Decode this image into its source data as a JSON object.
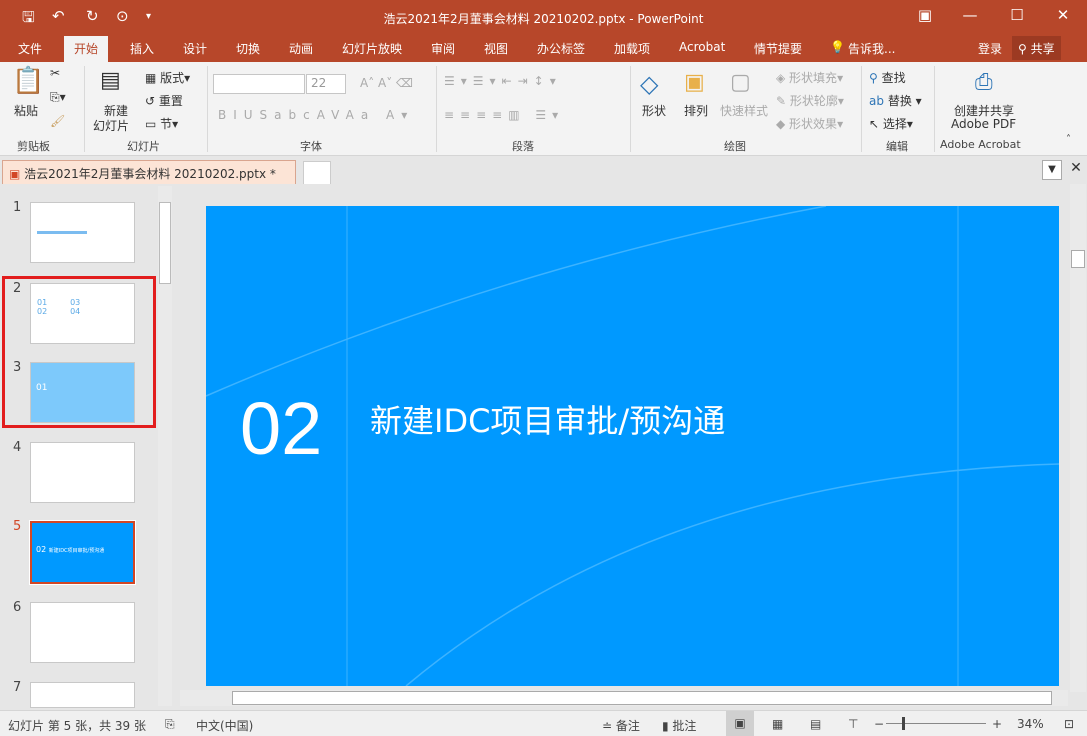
{
  "window": {
    "title": "浩云2021年2月董事会材料 20210202.pptx - PowerPoint"
  },
  "ribbon_tabs": [
    "文件",
    "开始",
    "插入",
    "设计",
    "切换",
    "动画",
    "幻灯片放映",
    "审阅",
    "视图",
    "办公标签",
    "加载项",
    "Acrobat",
    "情节提要",
    "告诉我..."
  ],
  "account": {
    "login": "登录",
    "share": "共享"
  },
  "clipboard": {
    "paste": "粘贴",
    "group": "剪贴板"
  },
  "slides_group": {
    "new_slide_1": "新建",
    "new_slide_2": "幻灯片",
    "layout": "版式",
    "reset": "重置",
    "section": "节",
    "group": "幻灯片"
  },
  "font": {
    "name": "",
    "size": "22",
    "group": "字体"
  },
  "paragraph": {
    "group": "段落"
  },
  "drawing": {
    "shape": "形状",
    "arrange": "排列",
    "quick_styles": "快速样式",
    "fill": "形状填充",
    "outline": "形状轮廓",
    "effects": "形状效果",
    "group": "绘图"
  },
  "editing": {
    "find": "查找",
    "replace": "替换",
    "select": "选择",
    "group": "编辑"
  },
  "acrobat": {
    "create_1": "创建并共享",
    "create_2": "Adobe PDF",
    "group": "Adobe Acrobat"
  },
  "document_tab": {
    "label": "浩云2021年2月董事会材料 20210202.pptx *"
  },
  "thumbnails": [
    {
      "num": "1"
    },
    {
      "num": "2"
    },
    {
      "num": "3"
    },
    {
      "num": "4"
    },
    {
      "num": "5",
      "selected": true
    },
    {
      "num": "6"
    },
    {
      "num": "7"
    }
  ],
  "slide": {
    "number": "02",
    "title": "新建IDC项目审批/预沟通",
    "background": "#0099ff"
  },
  "status": {
    "slide_info": "幻灯片 第 5 张，共 39 张",
    "language": "中文(中国)",
    "notes": "备注",
    "comments": "批注",
    "zoom": "34%"
  },
  "colors": {
    "accent": "#b7472a"
  }
}
